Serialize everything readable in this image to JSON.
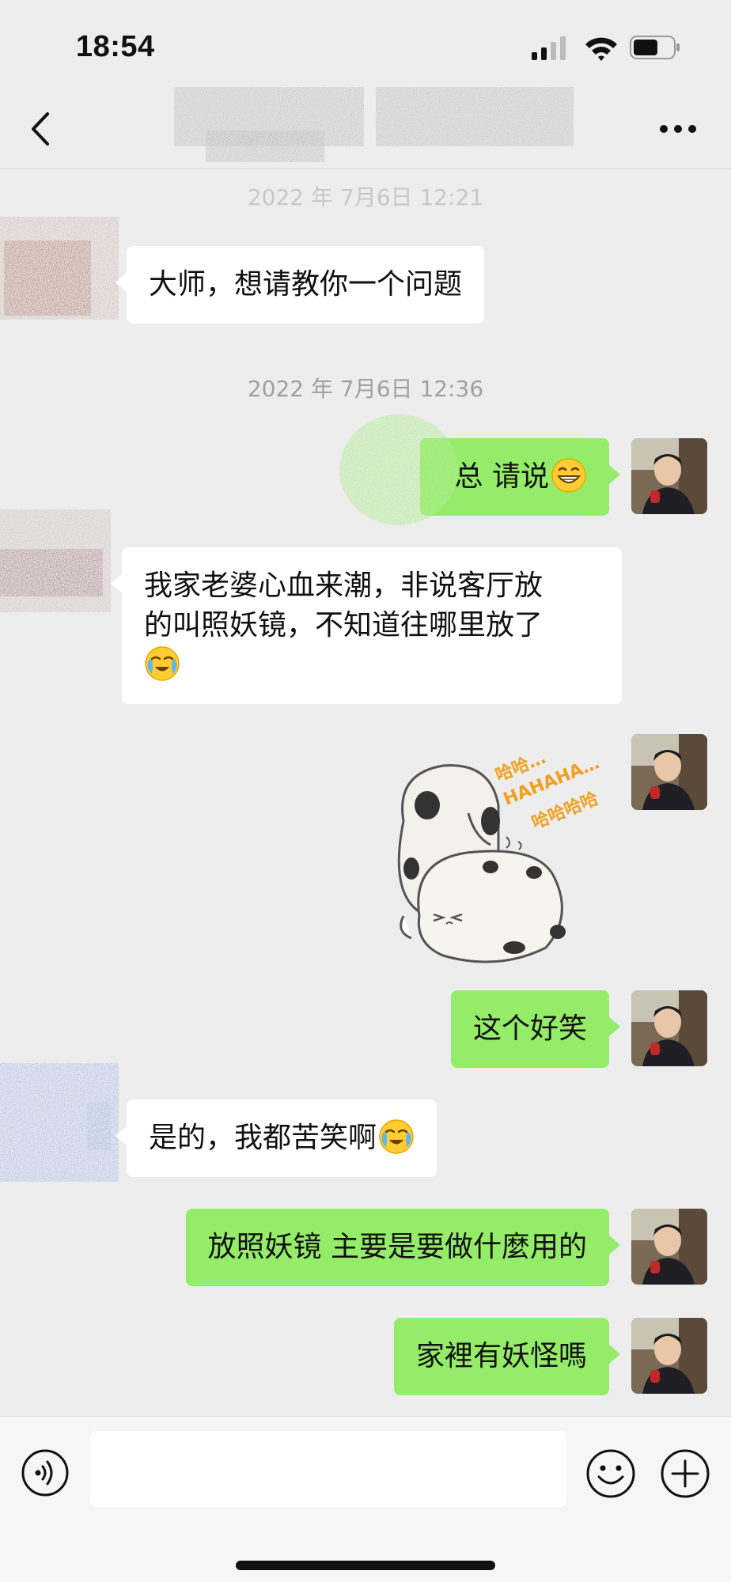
{
  "status_bar": {
    "time": "18:54"
  },
  "nav_bar": {
    "title": ""
  },
  "messages": [
    {
      "type": "timestamp",
      "text": "2022 年 7月6日 12:21"
    },
    {
      "type": "text",
      "side": "left",
      "text": "大师，想请教你一个问题"
    },
    {
      "type": "timestamp",
      "text": "2022 年 7月6日 12:36"
    },
    {
      "type": "text",
      "side": "right",
      "text": "总 请说",
      "emoji": "grinning-face-emoji"
    },
    {
      "type": "text",
      "side": "left",
      "line1": "我家老婆心血来潮，非说客厅放",
      "line2": "的叫照妖镜，不知道往哪里放了",
      "emoji": "loudly-crying-face-emoji"
    },
    {
      "type": "sticker",
      "side": "right",
      "sticker_text_1": "哈哈…",
      "sticker_text_2": "HAHAHA…",
      "sticker_text_3": "哈哈哈哈"
    },
    {
      "type": "text",
      "side": "right",
      "text": "这个好笑"
    },
    {
      "type": "text",
      "side": "left",
      "text": "是的，我都苦笑啊",
      "emoji": "loudly-crying-face-emoji"
    },
    {
      "type": "text",
      "side": "right",
      "text": "放照妖镜 主要是要做什麼用的"
    },
    {
      "type": "text",
      "side": "right",
      "text": "家裡有妖怪嗎"
    }
  ],
  "input": {
    "value": "",
    "placeholder": ""
  },
  "colors": {
    "background": "#ededed",
    "bubble_out": "#95ec69",
    "bubble_in": "#ffffff",
    "timestamp": "#a0a0a0"
  }
}
